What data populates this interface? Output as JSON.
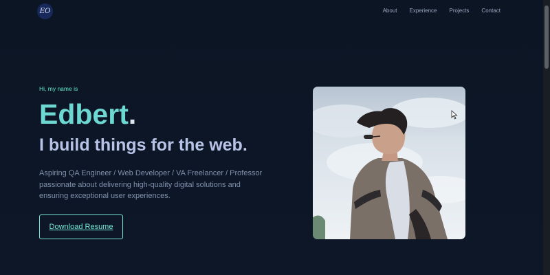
{
  "header": {
    "logo_text": "EO",
    "nav": [
      "About",
      "Experience",
      "Projects",
      "Contact"
    ]
  },
  "hero": {
    "greeting": "Hi, my name is",
    "name": "Edbert",
    "name_suffix": ".",
    "tagline": "I build things for the web.",
    "description": "Aspiring QA Engineer / Web Developer / VA Freelancer / Professor passionate about delivering high-quality digital solutions and ensuring exceptional user experiences.",
    "button_label": "Download Resume"
  },
  "colors": {
    "accent": "#6dd8d1",
    "background": "#0d1626"
  }
}
